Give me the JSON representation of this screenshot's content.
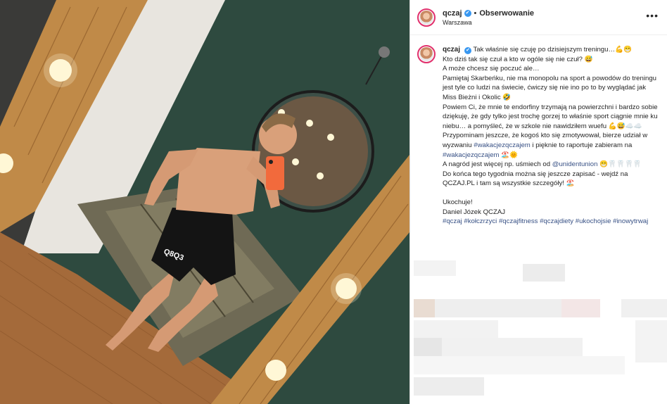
{
  "post": {
    "username": "qczaj",
    "verified_glyph": "✔",
    "separator": "•",
    "follow_label": "Obserwowanie",
    "location": "Warszawa",
    "more_glyph": "•••"
  },
  "caption": {
    "username": "qczaj",
    "lines": [
      "Tak właśnie się czuję po dzisiejszym treningu…💪😁",
      "Kto dziś tak się czuł a kto w ogóle się nie czuł? 😅",
      "A może chcesz się poczuć ale…",
      "Pamiętaj Skarbeńku, nie ma monopolu na sport a powodów do treningu jest tyle co ludzi na świecie, ćwiczy się nie ino po to by wyglądać jak Miss Bieżni i Okolic 🤣",
      "Powiem Ci, że mnie te endorfiny trzymają na powierzchni i bardzo sobie dziękuję, że gdy tylko jest trochę gorzej to właśnie sport ciągnie mnie ku niebu… a pomyśleć, że w szkole nie nawidziłem wuefu 💪😅☁️☁️"
    ],
    "reminder_pre": "Przypominam jeszcze, że kogoś kto się zmotywował, bierze udział w wyzwaniu ",
    "reminder_tag": "#wakacjezqczajem",
    "reminder_mid": " i pięknie to raportuje zabieram na ",
    "reminder_tag2": "#wakacjezqczajem",
    "reminder_end": " 🏖️🌞",
    "reward_pre": "A nagród jest więcej np. uśmiech od ",
    "reward_mention": "@unidentunion",
    "reward_end": " 😁🦷🦷🦷🦷",
    "signup": "Do końca tego tygodnia można się jeszcze zapisać - wejdź na QCZAJ.PL i tam są wszystkie szczegóły! 🏖️",
    "signoff": "Ukochuje!",
    "signature": "Daniel Józek QCZAJ",
    "hashtags": "#qczaj #kołczrzyci #qczajfitness #qczajdiety #ukochojsie #inowytrwaj"
  },
  "photo": {
    "shorts_text": "Q8Q3",
    "accent_colors": {
      "wall_green": "#2e4a3f",
      "wood": "#b07a3a",
      "phone_case": "#f26a3c",
      "lamp": "#fff7d6"
    }
  }
}
